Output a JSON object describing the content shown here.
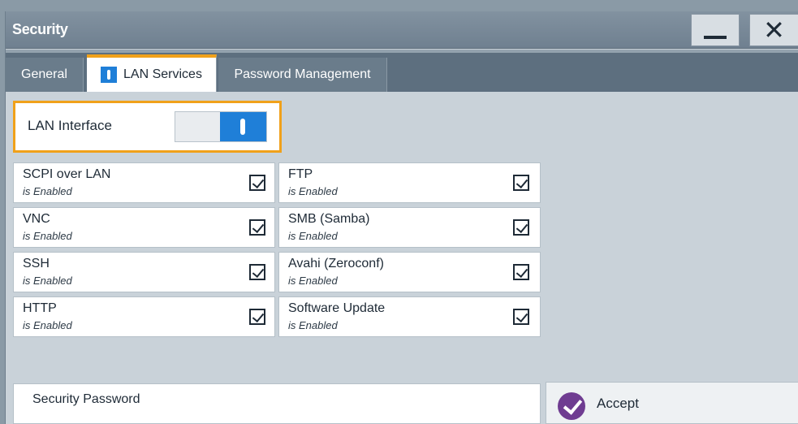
{
  "window": {
    "title": "Security",
    "minimize_icon": "minimize-icon",
    "close_icon": "close-icon",
    "close_glyph": "✕"
  },
  "tabs": [
    {
      "label": "General",
      "active": false
    },
    {
      "label": "LAN Services",
      "active": true
    },
    {
      "label": "Password Management",
      "active": false
    }
  ],
  "lan_interface": {
    "label": "LAN Interface",
    "state": "on"
  },
  "services": [
    {
      "name": "SCPI over LAN",
      "status": "is Enabled",
      "checked": true
    },
    {
      "name": "FTP",
      "status": "is Enabled",
      "checked": true
    },
    {
      "name": "VNC",
      "status": "is Enabled",
      "checked": true
    },
    {
      "name": "SMB (Samba)",
      "status": "is Enabled",
      "checked": true
    },
    {
      "name": "SSH",
      "status": "is Enabled",
      "checked": true
    },
    {
      "name": "Avahi (Zeroconf)",
      "status": "is Enabled",
      "checked": true
    },
    {
      "name": "HTTP",
      "status": "is Enabled",
      "checked": true
    },
    {
      "name": "Software Update",
      "status": "is Enabled",
      "checked": true
    }
  ],
  "security_password": {
    "label": "Security Password"
  },
  "accept": {
    "label": "Accept",
    "icon": "checkmark-icon"
  },
  "colors": {
    "accent_orange": "#f0a11a",
    "toggle_blue": "#1f7fd8",
    "accept_purple": "#6f3c91"
  }
}
